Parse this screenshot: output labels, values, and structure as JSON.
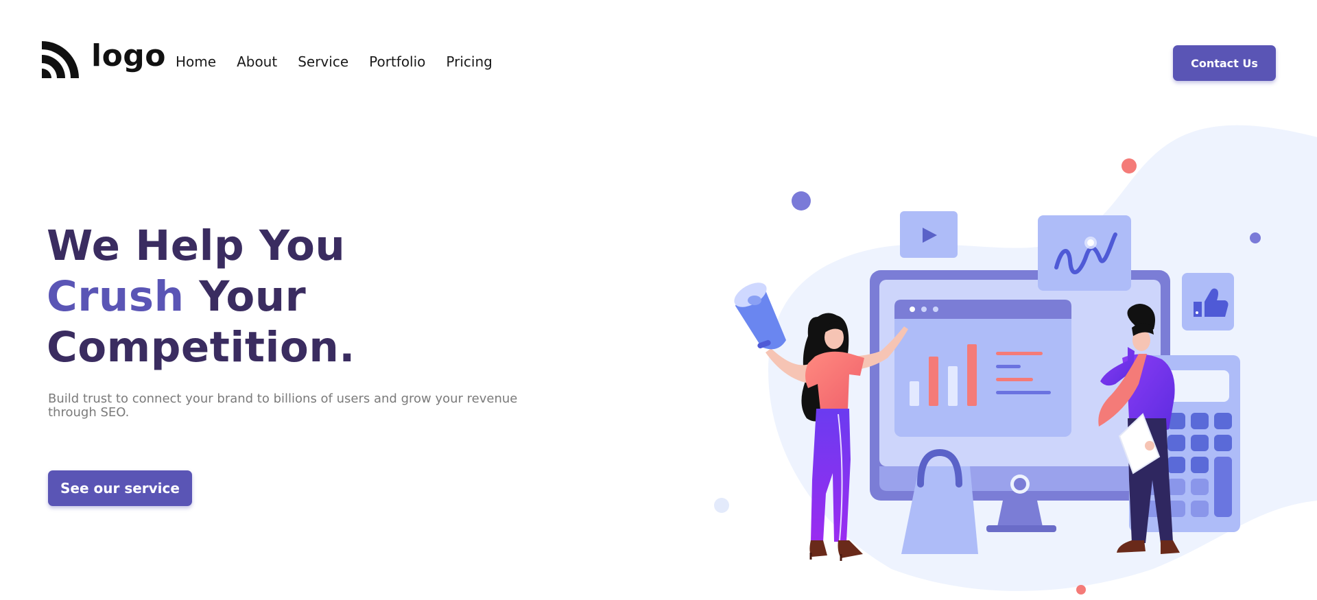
{
  "logo": {
    "text": "logo",
    "icon": "rss-arcs-icon"
  },
  "nav": {
    "items": [
      {
        "label": "Home"
      },
      {
        "label": "About"
      },
      {
        "label": "Service"
      },
      {
        "label": "Portfolio"
      },
      {
        "label": "Pricing"
      }
    ]
  },
  "header": {
    "contact_label": "Contact Us"
  },
  "hero": {
    "title_line1": "We Help You",
    "title_accent": "Crush",
    "title_line2_rest": " Your",
    "title_line3": "Competition.",
    "subtitle": "Build trust to connect your brand to billions of users and grow your revenue through SEO.",
    "cta_label": "See our service"
  },
  "colors": {
    "primary": "#5a55b5",
    "heading": "#3a2c60",
    "subtitle": "#7a7a7a",
    "blob": "#eef3fe",
    "accent_coral": "#f47b78"
  }
}
